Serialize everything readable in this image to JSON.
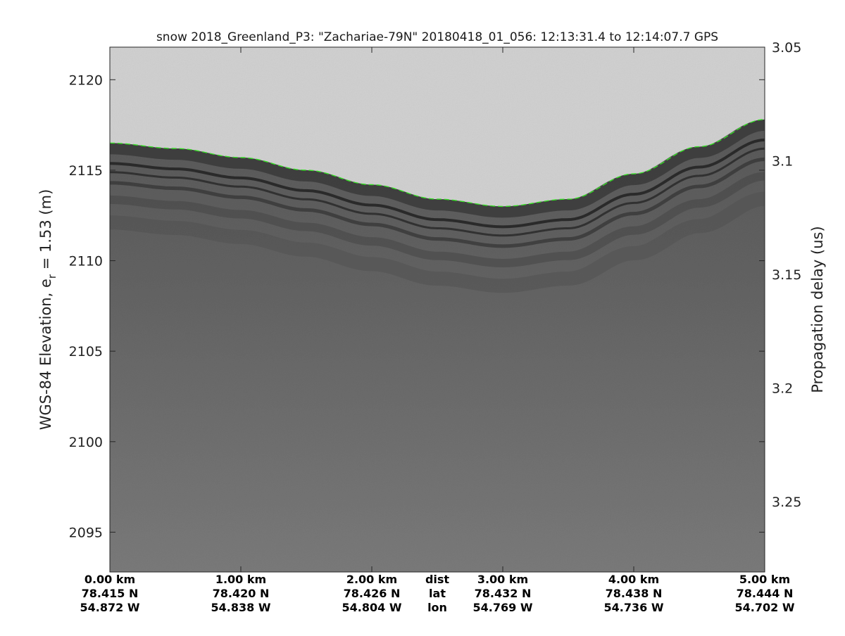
{
  "chart_data": {
    "type": "heatmap",
    "title": "snow 2018_Greenland_P3: \"Zachariae-79N\"  20180418_01_056: 12:13:31.4 to 12:14:07.7 GPS",
    "ylabel_main": "WGS-84 Elevation, e",
    "ylabel_sub": "r",
    "ylabel_tail": " = 1.53 (m)",
    "y2label": "Propagation delay (us)",
    "ylim": [
      2092.8,
      2121.8
    ],
    "yticks": [
      2095,
      2100,
      2105,
      2110,
      2115,
      2120
    ],
    "y2lim": [
      3.05,
      3.281
    ],
    "y2ticks": [
      "3.05",
      "3.1",
      "3.15",
      "3.2",
      "3.25"
    ],
    "xlim": [
      0,
      5
    ],
    "xticks": [
      {
        "dist": "0.00 km",
        "lat": "78.415 N",
        "lon": "54.872 W"
      },
      {
        "dist": "1.00 km",
        "lat": "78.420 N",
        "lon": "54.838 W"
      },
      {
        "dist": "2.00 km",
        "lat": "78.426 N",
        "lon": "54.804 W"
      },
      {
        "dist": "3.00 km",
        "lat": "78.432 N",
        "lon": "54.769 W"
      },
      {
        "dist": "4.00 km",
        "lat": "78.438 N",
        "lon": "54.736 W"
      },
      {
        "dist": "5.00 km",
        "lat": "78.444 N",
        "lon": "54.702 W"
      }
    ],
    "xrow_labels": {
      "dist": "dist",
      "lat": "lat",
      "lon": "lon"
    },
    "surface_elevation": {
      "x": [
        0,
        0.5,
        1.0,
        1.5,
        2.0,
        2.5,
        3.0,
        3.5,
        4.0,
        4.5,
        5.0
      ],
      "y": [
        2116.5,
        2116.2,
        2115.7,
        2115.0,
        2114.2,
        2113.4,
        2113.0,
        2113.4,
        2114.8,
        2116.3,
        2117.8
      ]
    },
    "colors": {
      "air": "#d4d4d4",
      "surface_layer": "#3a3a3a",
      "near_surface": "#555555",
      "deep": "#7a7a7a",
      "surface_trace": "#33dd22"
    },
    "grid": false
  }
}
